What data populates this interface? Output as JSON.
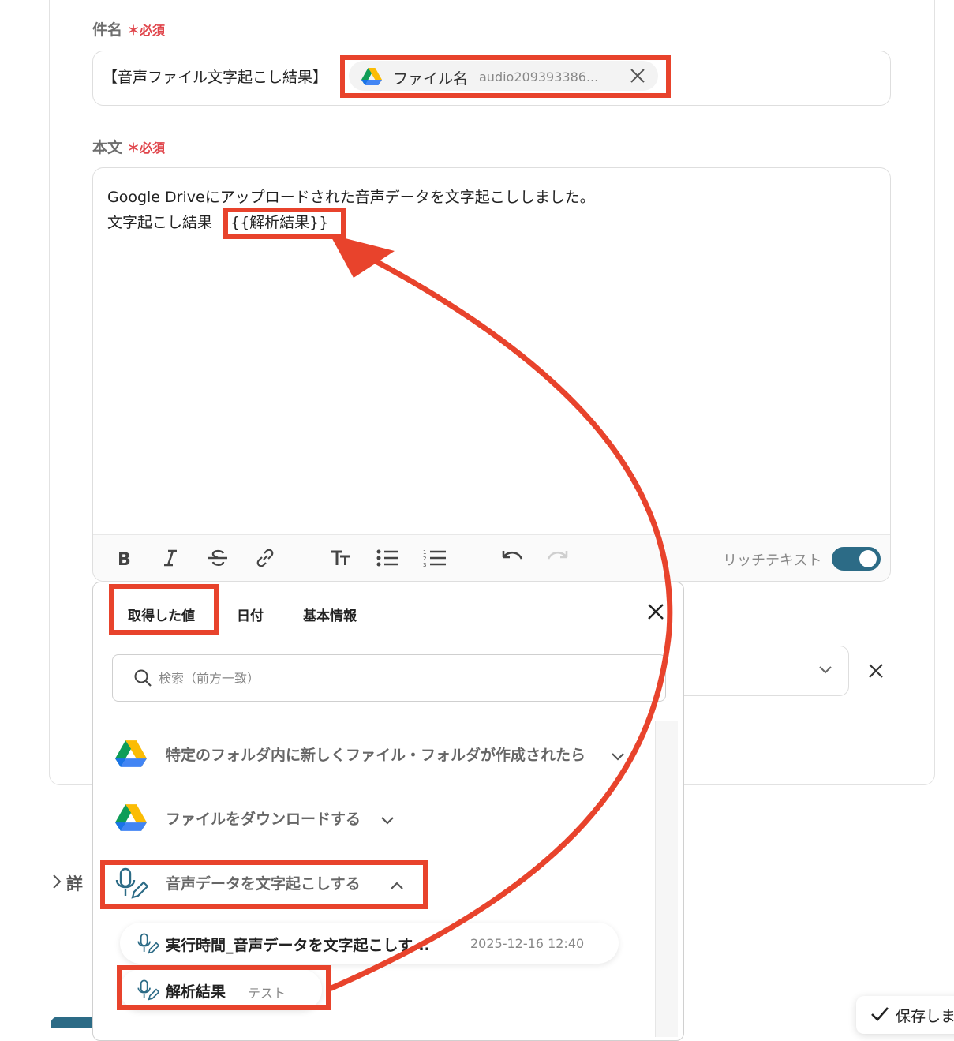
{
  "subject": {
    "label": "件名",
    "required_mark": "＊",
    "required_text": "必須",
    "prefix_text": "【音声ファイル文字起こし結果】",
    "chip": {
      "name": "ファイル名",
      "value": "audio209393386...",
      "icon": "google-drive-icon"
    }
  },
  "body_field": {
    "label": "本文",
    "required_mark": "＊",
    "required_text": "必須",
    "line1": "Google Driveにアップロードされた音声データを文字起こししました。",
    "line2_prefix": "文字起こし結果",
    "line2_var": "{{解析結果}}"
  },
  "toolbar": {
    "buttons": [
      "bold-icon",
      "italic-icon",
      "strikethrough-icon",
      "link-icon",
      "text-size-icon",
      "bullet-list-icon",
      "numbered-list-icon",
      "undo-icon",
      "redo-icon"
    ],
    "rich_text_label": "リッチテキスト",
    "rich_text_on": true
  },
  "panel": {
    "tabs": [
      "取得した値",
      "日付",
      "基本情報"
    ],
    "active_tab": 0,
    "search_placeholder": "検索（前方一致）",
    "groups": [
      {
        "name": "特定のフォルダ内に新しくファイル・フォルダが作成されたら",
        "icon": "google-drive-icon",
        "expanded": false
      },
      {
        "name": "ファイルをダウンロードする",
        "icon": "google-drive-icon",
        "expanded": false
      },
      {
        "name": "音声データを文字起こしする",
        "icon": "microphone-pen-icon",
        "expanded": true
      }
    ],
    "items": [
      {
        "name": "実行時間_音声データを文字起こしす...",
        "value": "2025-12-16 12:40"
      },
      {
        "name": "解析結果",
        "value": "テスト"
      }
    ]
  },
  "details_label": "詳",
  "save_label": "保存しま",
  "colors": {
    "accent": "#2c6b86",
    "highlight": "#e8432c",
    "required": "#e0454b"
  }
}
